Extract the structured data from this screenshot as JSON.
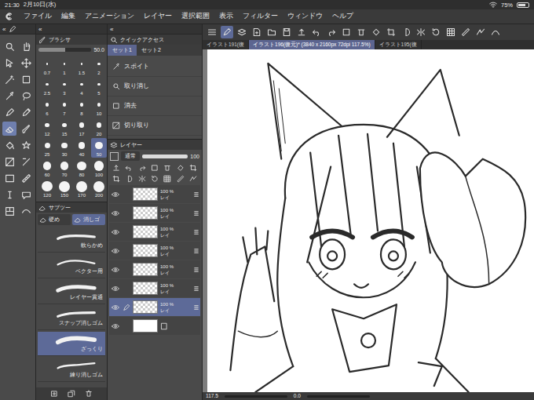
{
  "status_bar": {
    "time": "21:30",
    "date": "2月10日(水)",
    "battery": "75%",
    "battery_level": 0.75
  },
  "menu": [
    "ファイル",
    "編集",
    "アニメーション",
    "レイヤー",
    "選択範囲",
    "表示",
    "フィルター",
    "ウィンドウ",
    "ヘルプ"
  ],
  "collapse_glyph": "«",
  "tools": [
    {
      "selected": false
    },
    {
      "selected": false
    },
    {
      "selected": false
    },
    {
      "selected": false
    },
    {
      "selected": false
    },
    {
      "selected": false
    },
    {
      "selected": false
    },
    {
      "selected": false
    },
    {
      "selected": false
    },
    {
      "selected": false
    },
    {
      "selected": true
    },
    {
      "selected": false
    },
    {
      "selected": false
    },
    {
      "selected": false
    },
    {
      "selected": false
    },
    {
      "selected": false
    },
    {
      "selected": false
    },
    {
      "selected": false
    },
    {
      "selected": false
    },
    {
      "selected": false
    },
    {
      "selected": false
    },
    {
      "selected": false
    }
  ],
  "brush_size": {
    "title": "ブラシサ",
    "reading": "50.0",
    "level": 0.5,
    "sizes": [
      {
        "label": "0.7",
        "selected": false
      },
      {
        "label": "1",
        "selected": false
      },
      {
        "label": "1.5",
        "selected": false
      },
      {
        "label": "2",
        "selected": false
      },
      {
        "label": "2.5",
        "selected": false
      },
      {
        "label": "3",
        "selected": false
      },
      {
        "label": "4",
        "selected": false
      },
      {
        "label": "5",
        "selected": false
      },
      {
        "label": "6",
        "selected": false
      },
      {
        "label": "7",
        "selected": false
      },
      {
        "label": "8",
        "selected": false
      },
      {
        "label": "10",
        "selected": false
      },
      {
        "label": "12",
        "selected": false
      },
      {
        "label": "15",
        "selected": false
      },
      {
        "label": "17",
        "selected": false
      },
      {
        "label": "20",
        "selected": false
      },
      {
        "label": "25",
        "selected": false
      },
      {
        "label": "30",
        "selected": false
      },
      {
        "label": "40",
        "selected": false
      },
      {
        "label": "50",
        "selected": true
      },
      {
        "label": "60",
        "selected": false
      },
      {
        "label": "70",
        "selected": false
      },
      {
        "label": "80",
        "selected": false
      },
      {
        "label": "100",
        "selected": false
      },
      {
        "label": "120",
        "selected": false
      },
      {
        "label": "150",
        "selected": false
      },
      {
        "label": "170",
        "selected": false
      },
      {
        "label": "200",
        "selected": false
      }
    ]
  },
  "sub_tool": {
    "title": "サブツー",
    "tabs": [
      {
        "label": "硬め",
        "selected": false
      },
      {
        "label": "消しゴ",
        "selected": true
      }
    ],
    "items": [
      {
        "label": "軟らかめ",
        "selected": false
      },
      {
        "label": "ベクター用",
        "selected": false
      },
      {
        "label": "レイヤー貫通",
        "selected": false
      },
      {
        "label": "スナップ消しゴム",
        "selected": false
      },
      {
        "label": "ざっくり",
        "selected": true
      },
      {
        "label": "練り消しゴム",
        "selected": false
      }
    ]
  },
  "quick_access": {
    "title": "クイックアクセス",
    "tabs": [
      {
        "label": "セット1",
        "selected": true
      },
      {
        "label": "セット2",
        "selected": false
      }
    ],
    "items": [
      "スポイト",
      "取り消し",
      "消去",
      "切り取り"
    ]
  },
  "layers": {
    "title": "レイヤー",
    "blend": "通常",
    "opacity": "100",
    "rows": [
      {
        "kind": "raster",
        "opacity": "100 %",
        "name": "レイ",
        "visible": true,
        "selected": false
      },
      {
        "kind": "raster",
        "opacity": "100 %",
        "name": "レイ",
        "visible": true,
        "selected": false
      },
      {
        "kind": "raster",
        "opacity": "100 %",
        "name": "レイ",
        "visible": true,
        "selected": false
      },
      {
        "kind": "raster",
        "opacity": "100 %",
        "name": "レイ",
        "visible": true,
        "selected": false
      },
      {
        "kind": "raster",
        "opacity": "100 %",
        "name": "レイ",
        "visible": true,
        "selected": false
      },
      {
        "kind": "raster",
        "opacity": "100 %",
        "name": "レイ",
        "visible": true,
        "selected": false
      },
      {
        "kind": "raster",
        "opacity": "100 %",
        "name": "レイ",
        "visible": true,
        "selected": true
      },
      {
        "kind": "paper",
        "visible": true,
        "selected": false
      }
    ]
  },
  "canvas_tabs": [
    {
      "label": "イラスト191(復",
      "selected": false
    },
    {
      "label": "イラスト196(復元)* (3840 x 2160px 72dpi 117.5%)",
      "selected": true
    },
    {
      "label": "イラスト195(復",
      "selected": false
    }
  ],
  "canvas_status": {
    "zoom": "117.5",
    "angle": "0.0"
  }
}
